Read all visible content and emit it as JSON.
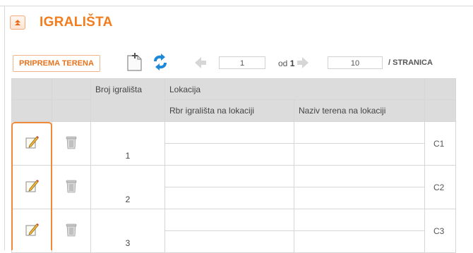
{
  "panel": {
    "title": "IGRALIŠTA",
    "collapse_icon": "collapse-up-icon"
  },
  "toolbar": {
    "prep_button_label": "PRIPREMA TERENA",
    "new_icon": "new-document-icon",
    "refresh_icon": "refresh-icon",
    "prev_icon": "arrow-left-icon",
    "next_icon": "arrow-right-icon",
    "current_page": "1",
    "of_label": "od",
    "total_pages": "1",
    "page_size": "10",
    "per_page_label": "/ STRANICA"
  },
  "table": {
    "headers": {
      "number": "Broj igrališta",
      "location": "Lokacija",
      "rbr": "Rbr igrališta na lokaciji",
      "name": "Naziv terena na lokaciji"
    },
    "rows": [
      {
        "number": "1",
        "code": "C1"
      },
      {
        "number": "2",
        "code": "C2"
      },
      {
        "number": "3",
        "code": "C3"
      }
    ]
  },
  "colors": {
    "accent": "#f27d1e",
    "header_bg": "#dcdcdc",
    "border": "#d6d6d6"
  }
}
